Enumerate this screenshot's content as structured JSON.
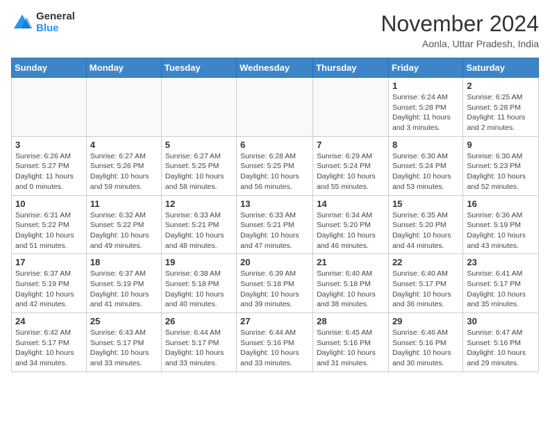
{
  "logo": {
    "general": "General",
    "blue": "Blue"
  },
  "title": "November 2024",
  "location": "Aonla, Uttar Pradesh, India",
  "weekdays": [
    "Sunday",
    "Monday",
    "Tuesday",
    "Wednesday",
    "Thursday",
    "Friday",
    "Saturday"
  ],
  "weeks": [
    [
      {
        "day": "",
        "info": ""
      },
      {
        "day": "",
        "info": ""
      },
      {
        "day": "",
        "info": ""
      },
      {
        "day": "",
        "info": ""
      },
      {
        "day": "",
        "info": ""
      },
      {
        "day": "1",
        "info": "Sunrise: 6:24 AM\nSunset: 5:28 PM\nDaylight: 11 hours\nand 3 minutes."
      },
      {
        "day": "2",
        "info": "Sunrise: 6:25 AM\nSunset: 5:28 PM\nDaylight: 11 hours\nand 2 minutes."
      }
    ],
    [
      {
        "day": "3",
        "info": "Sunrise: 6:26 AM\nSunset: 5:27 PM\nDaylight: 11 hours\nand 0 minutes."
      },
      {
        "day": "4",
        "info": "Sunrise: 6:27 AM\nSunset: 5:26 PM\nDaylight: 10 hours\nand 59 minutes."
      },
      {
        "day": "5",
        "info": "Sunrise: 6:27 AM\nSunset: 5:25 PM\nDaylight: 10 hours\nand 58 minutes."
      },
      {
        "day": "6",
        "info": "Sunrise: 6:28 AM\nSunset: 5:25 PM\nDaylight: 10 hours\nand 56 minutes."
      },
      {
        "day": "7",
        "info": "Sunrise: 6:29 AM\nSunset: 5:24 PM\nDaylight: 10 hours\nand 55 minutes."
      },
      {
        "day": "8",
        "info": "Sunrise: 6:30 AM\nSunset: 5:24 PM\nDaylight: 10 hours\nand 53 minutes."
      },
      {
        "day": "9",
        "info": "Sunrise: 6:30 AM\nSunset: 5:23 PM\nDaylight: 10 hours\nand 52 minutes."
      }
    ],
    [
      {
        "day": "10",
        "info": "Sunrise: 6:31 AM\nSunset: 5:22 PM\nDaylight: 10 hours\nand 51 minutes."
      },
      {
        "day": "11",
        "info": "Sunrise: 6:32 AM\nSunset: 5:22 PM\nDaylight: 10 hours\nand 49 minutes."
      },
      {
        "day": "12",
        "info": "Sunrise: 6:33 AM\nSunset: 5:21 PM\nDaylight: 10 hours\nand 48 minutes."
      },
      {
        "day": "13",
        "info": "Sunrise: 6:33 AM\nSunset: 5:21 PM\nDaylight: 10 hours\nand 47 minutes."
      },
      {
        "day": "14",
        "info": "Sunrise: 6:34 AM\nSunset: 5:20 PM\nDaylight: 10 hours\nand 46 minutes."
      },
      {
        "day": "15",
        "info": "Sunrise: 6:35 AM\nSunset: 5:20 PM\nDaylight: 10 hours\nand 44 minutes."
      },
      {
        "day": "16",
        "info": "Sunrise: 6:36 AM\nSunset: 5:19 PM\nDaylight: 10 hours\nand 43 minutes."
      }
    ],
    [
      {
        "day": "17",
        "info": "Sunrise: 6:37 AM\nSunset: 5:19 PM\nDaylight: 10 hours\nand 42 minutes."
      },
      {
        "day": "18",
        "info": "Sunrise: 6:37 AM\nSunset: 5:19 PM\nDaylight: 10 hours\nand 41 minutes."
      },
      {
        "day": "19",
        "info": "Sunrise: 6:38 AM\nSunset: 5:18 PM\nDaylight: 10 hours\nand 40 minutes."
      },
      {
        "day": "20",
        "info": "Sunrise: 6:39 AM\nSunset: 5:18 PM\nDaylight: 10 hours\nand 39 minutes."
      },
      {
        "day": "21",
        "info": "Sunrise: 6:40 AM\nSunset: 5:18 PM\nDaylight: 10 hours\nand 38 minutes."
      },
      {
        "day": "22",
        "info": "Sunrise: 6:40 AM\nSunset: 5:17 PM\nDaylight: 10 hours\nand 36 minutes."
      },
      {
        "day": "23",
        "info": "Sunrise: 6:41 AM\nSunset: 5:17 PM\nDaylight: 10 hours\nand 35 minutes."
      }
    ],
    [
      {
        "day": "24",
        "info": "Sunrise: 6:42 AM\nSunset: 5:17 PM\nDaylight: 10 hours\nand 34 minutes."
      },
      {
        "day": "25",
        "info": "Sunrise: 6:43 AM\nSunset: 5:17 PM\nDaylight: 10 hours\nand 33 minutes."
      },
      {
        "day": "26",
        "info": "Sunrise: 6:44 AM\nSunset: 5:17 PM\nDaylight: 10 hours\nand 33 minutes."
      },
      {
        "day": "27",
        "info": "Sunrise: 6:44 AM\nSunset: 5:16 PM\nDaylight: 10 hours\nand 33 minutes."
      },
      {
        "day": "28",
        "info": "Sunrise: 6:45 AM\nSunset: 5:16 PM\nDaylight: 10 hours\nand 31 minutes."
      },
      {
        "day": "29",
        "info": "Sunrise: 6:46 AM\nSunset: 5:16 PM\nDaylight: 10 hours\nand 30 minutes."
      },
      {
        "day": "30",
        "info": "Sunrise: 6:47 AM\nSunset: 5:16 PM\nDaylight: 10 hours\nand 29 minutes."
      }
    ]
  ]
}
